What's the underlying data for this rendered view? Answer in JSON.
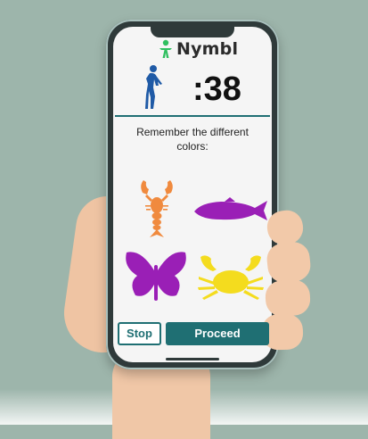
{
  "app": {
    "logo_text": "Nymbl"
  },
  "exercise": {
    "timer": ":38",
    "instruction": "Remember the different colors:"
  },
  "cards": [
    {
      "icon": "lobster-icon",
      "color": "#f08a3e"
    },
    {
      "icon": "fish-icon",
      "color": "#9a1fb6"
    },
    {
      "icon": "butterfly-icon",
      "color": "#9a1fb6"
    },
    {
      "icon": "crab-icon",
      "color": "#f4dc1e"
    }
  ],
  "buttons": {
    "stop_label": "Stop",
    "proceed_label": "Proceed"
  },
  "colors": {
    "accent": "#1f6f73",
    "logo_green": "#2fbf5f",
    "figure_blue": "#1f5aa6"
  }
}
